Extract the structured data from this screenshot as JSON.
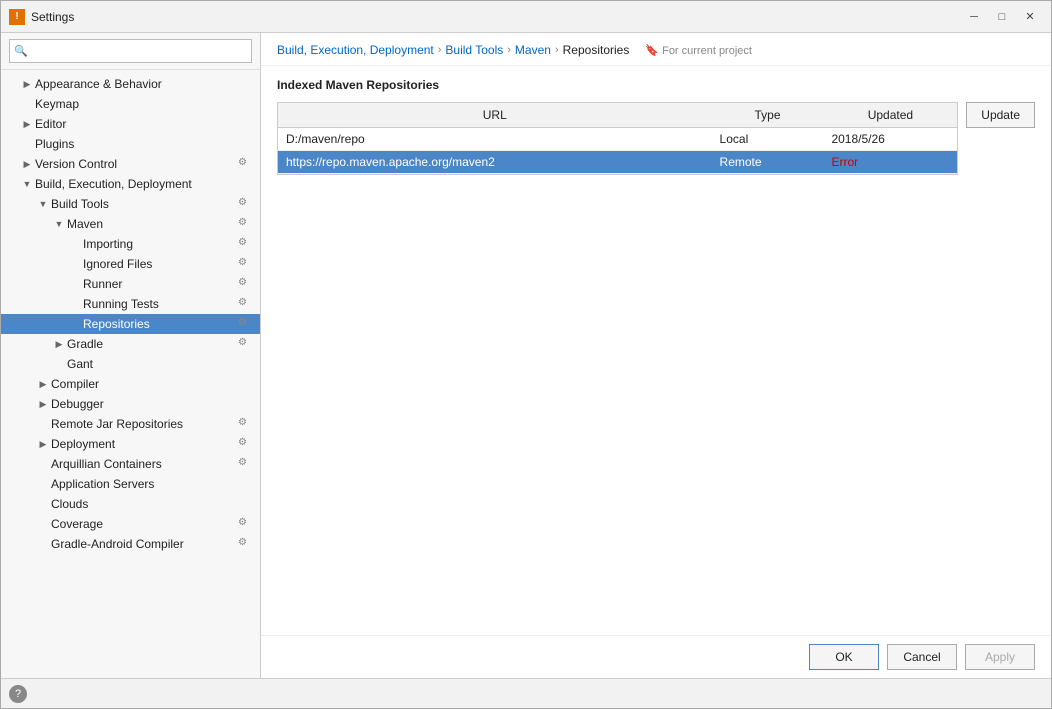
{
  "window": {
    "title": "Settings",
    "icon": "!!"
  },
  "search": {
    "placeholder": ""
  },
  "breadcrumb": {
    "parts": [
      {
        "label": "Build, Execution, Deployment",
        "type": "link"
      },
      {
        "label": "›",
        "type": "sep"
      },
      {
        "label": "Build Tools",
        "type": "link"
      },
      {
        "label": "›",
        "type": "sep"
      },
      {
        "label": "Maven",
        "type": "link"
      },
      {
        "label": "›",
        "type": "sep"
      },
      {
        "label": "Repositories",
        "type": "current"
      }
    ],
    "project_label": "For current project"
  },
  "section_title": "Indexed Maven Repositories",
  "table": {
    "headers": [
      "URL",
      "Type",
      "Updated"
    ],
    "rows": [
      {
        "url": "D:/maven/repo",
        "url_is_link": false,
        "type": "Local",
        "updated": "2018/5/26",
        "selected": false
      },
      {
        "url": "https://repo.maven.apache.org/maven2",
        "url_is_link": true,
        "type": "Remote",
        "updated": "Error",
        "updated_error": true,
        "selected": true
      }
    ]
  },
  "buttons": {
    "update": "Update",
    "ok": "OK",
    "cancel": "Cancel",
    "apply": "Apply"
  },
  "sidebar": {
    "items": [
      {
        "label": "Appearance & Behavior",
        "level": 0,
        "arrow": "▶",
        "has_icon": false,
        "selected": false,
        "id": "appearance"
      },
      {
        "label": "Keymap",
        "level": 0,
        "arrow": "",
        "has_icon": false,
        "selected": false,
        "id": "keymap"
      },
      {
        "label": "Editor",
        "level": 0,
        "arrow": "▶",
        "has_icon": false,
        "selected": false,
        "id": "editor"
      },
      {
        "label": "Plugins",
        "level": 0,
        "arrow": "",
        "has_icon": false,
        "selected": false,
        "id": "plugins"
      },
      {
        "label": "Version Control",
        "level": 0,
        "arrow": "▶",
        "has_icon": true,
        "selected": false,
        "id": "vcs"
      },
      {
        "label": "Build, Execution, Deployment",
        "level": 0,
        "arrow": "▼",
        "has_icon": true,
        "selected": false,
        "id": "build-exec"
      },
      {
        "label": "Build Tools",
        "level": 1,
        "arrow": "▼",
        "has_icon": true,
        "selected": false,
        "id": "build-tools"
      },
      {
        "label": "Maven",
        "level": 2,
        "arrow": "▼",
        "has_icon": true,
        "selected": false,
        "id": "maven"
      },
      {
        "label": "Importing",
        "level": 3,
        "arrow": "",
        "has_icon": true,
        "selected": false,
        "id": "importing"
      },
      {
        "label": "Ignored Files",
        "level": 3,
        "arrow": "",
        "has_icon": true,
        "selected": false,
        "id": "ignored-files"
      },
      {
        "label": "Runner",
        "level": 3,
        "arrow": "",
        "has_icon": true,
        "selected": false,
        "id": "runner"
      },
      {
        "label": "Running Tests",
        "level": 3,
        "arrow": "",
        "has_icon": true,
        "selected": false,
        "id": "running-tests"
      },
      {
        "label": "Repositories",
        "level": 3,
        "arrow": "",
        "has_icon": true,
        "selected": true,
        "id": "repositories"
      },
      {
        "label": "Gradle",
        "level": 2,
        "arrow": "▶",
        "has_icon": true,
        "selected": false,
        "id": "gradle"
      },
      {
        "label": "Gant",
        "level": 2,
        "arrow": "",
        "has_icon": false,
        "selected": false,
        "id": "gant"
      },
      {
        "label": "Compiler",
        "level": 1,
        "arrow": "▶",
        "has_icon": false,
        "selected": false,
        "id": "compiler"
      },
      {
        "label": "Debugger",
        "level": 1,
        "arrow": "▶",
        "has_icon": false,
        "selected": false,
        "id": "debugger"
      },
      {
        "label": "Remote Jar Repositories",
        "level": 1,
        "arrow": "",
        "has_icon": true,
        "selected": false,
        "id": "remote-jar"
      },
      {
        "label": "Deployment",
        "level": 1,
        "arrow": "▶",
        "has_icon": true,
        "selected": false,
        "id": "deployment"
      },
      {
        "label": "Arquillian Containers",
        "level": 1,
        "arrow": "",
        "has_icon": true,
        "selected": false,
        "id": "arquillian"
      },
      {
        "label": "Application Servers",
        "level": 1,
        "arrow": "",
        "has_icon": false,
        "selected": false,
        "id": "app-servers"
      },
      {
        "label": "Clouds",
        "level": 1,
        "arrow": "",
        "has_icon": false,
        "selected": false,
        "id": "clouds"
      },
      {
        "label": "Coverage",
        "level": 1,
        "arrow": "",
        "has_icon": true,
        "selected": false,
        "id": "coverage"
      },
      {
        "label": "Gradle-Android Compiler",
        "level": 1,
        "arrow": "",
        "has_icon": true,
        "selected": false,
        "id": "gradle-android"
      }
    ]
  }
}
